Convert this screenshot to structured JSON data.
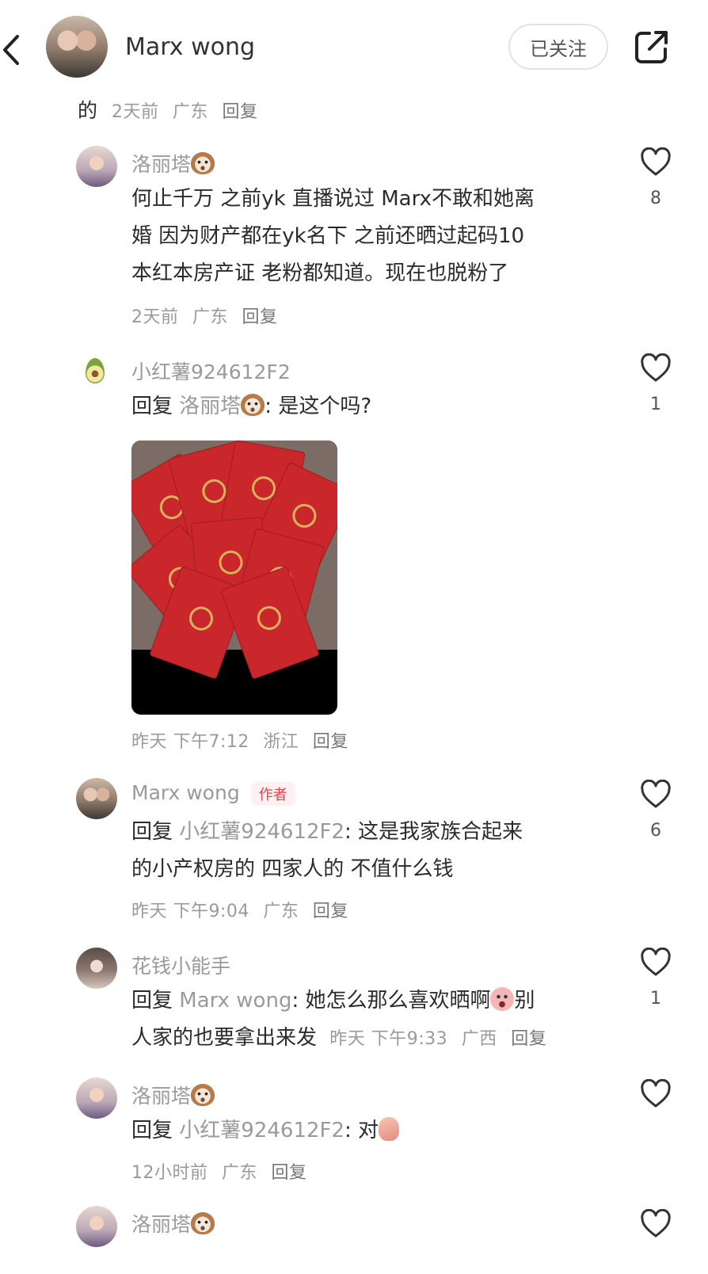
{
  "header": {
    "name": "Marx wong",
    "follow_label": "已关注"
  },
  "top_meta": {
    "prefix": "的",
    "time": "2天前",
    "location": "广东",
    "reply": "回复"
  },
  "comments": [
    {
      "user": "洛丽塔",
      "text_lines": [
        "何止千万 之前yk 直播说过 Marx不敢和她离",
        "婚 因为财产都在yk名下 之前还晒过起码10",
        "本红本房产证 老粉都知道。现在也脱粉了"
      ],
      "time": "2天前",
      "location": "广东",
      "reply": "回复",
      "likes": "8"
    },
    {
      "user": "小红薯924612F2",
      "reply_prefix": "回复",
      "reply_to": "洛丽塔",
      "text": ": 是这个吗?",
      "time": "昨天 下午7:12",
      "location": "浙江",
      "reply": "回复",
      "likes": "1"
    },
    {
      "user": "Marx wong",
      "tag": "作者",
      "reply_prefix": "回复",
      "reply_to": "小红薯924612F2",
      "text": ": 这是我家族合起来",
      "text_line2": "的小产权房的 四家人的 不值什么钱",
      "time": "昨天 下午9:04",
      "location": "广东",
      "reply": "回复",
      "likes": "6"
    },
    {
      "user": "花钱小能手",
      "reply_prefix": "回复",
      "reply_to": "Marx wong",
      "text": ": 她怎么那么喜欢晒啊",
      "text_after_emoji": "别",
      "text_line2": "人家的也要拿出来发",
      "time": "昨天 下午9:33",
      "location": "广西",
      "reply": "回复",
      "likes": "1"
    },
    {
      "user": "洛丽塔",
      "reply_prefix": "回复",
      "reply_to": "小红薯924612F2",
      "text": ": 对",
      "time": "12小时前",
      "location": "广东",
      "reply": "回复",
      "likes": ""
    },
    {
      "user": "洛丽塔"
    }
  ],
  "icons": {
    "back": "chevron-left-icon",
    "share": "share-icon",
    "like": "heart-outline-icon"
  },
  "colors": {
    "author_tag_bg": "#fff0f1",
    "author_tag_text": "#e0454f",
    "meta_gray": "#9a9a9a"
  }
}
